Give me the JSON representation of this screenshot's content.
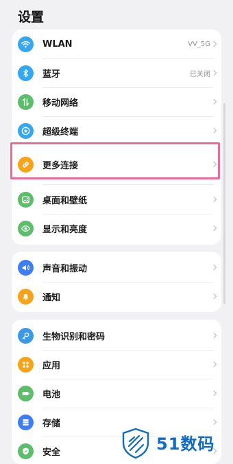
{
  "page_title": "设置",
  "colors": {
    "wlan_icon": "#35a7ef",
    "bluetooth_icon": "#35a7ef",
    "mobile_icon": "#5cbd6a",
    "super_device_icon": "#35a7ef",
    "more_connections_icon": "#f7a319",
    "wallpaper_icon": "#5cbd6a",
    "display_icon": "#5cbd6a",
    "sound_icon": "#3e7ef0",
    "notification_icon": "#f7a319",
    "biometrics_icon": "#3a9ae8",
    "apps_icon": "#f7a319",
    "battery_icon": "#5cbd6a",
    "storage_icon": "#3e7ef0",
    "security_icon": "#5cbd6a",
    "highlight": "#ec6a94",
    "watermark": "#0f6bc4"
  },
  "groups": [
    {
      "items": [
        {
          "label": "WLAN",
          "value": "VV_5G",
          "icon": "wifi-icon"
        },
        {
          "label": "蓝牙",
          "value": "已关闭",
          "icon": "bluetooth-icon"
        },
        {
          "label": "移动网络",
          "value": "",
          "icon": "mobile-network-icon"
        },
        {
          "label": "超级终端",
          "value": "",
          "icon": "super-device-icon"
        },
        {
          "label": "更多连接",
          "value": "",
          "icon": "link-icon"
        },
        {
          "label": "桌面和壁纸",
          "value": "",
          "icon": "wallpaper-icon"
        },
        {
          "label": "显示和亮度",
          "value": "",
          "icon": "eye-icon"
        }
      ]
    },
    {
      "items": [
        {
          "label": "声音和振动",
          "value": "",
          "icon": "speaker-icon"
        },
        {
          "label": "通知",
          "value": "",
          "icon": "bell-icon"
        }
      ]
    },
    {
      "items": [
        {
          "label": "生物识别和密码",
          "value": "",
          "icon": "key-icon"
        },
        {
          "label": "应用",
          "value": "",
          "icon": "apps-grid-icon"
        },
        {
          "label": "电池",
          "value": "",
          "icon": "battery-icon"
        },
        {
          "label": "存储",
          "value": "",
          "icon": "storage-icon"
        },
        {
          "label": "安全",
          "value": "",
          "icon": "shield-icon"
        }
      ]
    }
  ],
  "watermark": {
    "text": "51数码"
  }
}
